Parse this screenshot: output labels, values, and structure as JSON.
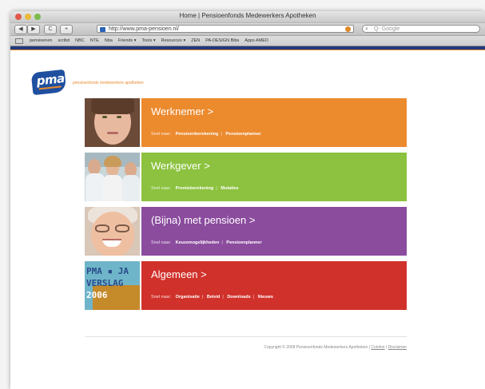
{
  "window": {
    "title": "Home | Pensioenfonds Medewerkers Apotheken"
  },
  "toolbar": {
    "url": "http://www.pma-pensioen.nl/",
    "search_placeholder": "Q- Google",
    "back": "◀",
    "forward": "▶",
    "reload": "C",
    "add": "+"
  },
  "bookmarks": [
    "pensioenen",
    "scribd",
    "NBC",
    "NTE",
    "Nba",
    "Friends ▾",
    "Tools ▾",
    "Resources ▾",
    "ZEN",
    "PA-DESIGN Bibs",
    "Apps AMED"
  ],
  "brand": {
    "logo": "pma",
    "tagline": "pensioenfonds medewerkers apotheken"
  },
  "label_go": "Snel naar:",
  "sections": [
    {
      "title": "Werknemer >",
      "color": "#ec8a2e",
      "links": [
        "Pensioenberekening",
        "Pensioenplanner"
      ]
    },
    {
      "title": "Werkgever >",
      "color": "#8cc23f",
      "links": [
        "Premieberekening",
        "Mutaties"
      ]
    },
    {
      "title": "(Bijna) met pensioen >",
      "color": "#8b4c9e",
      "links": [
        "Keuzemogelijkheden",
        "Pensioenplanner"
      ]
    },
    {
      "title": "Algemeen >",
      "color": "#d1312b",
      "links": [
        "Organisatie",
        "Beleid",
        "Downloads",
        "Nieuws"
      ]
    }
  ],
  "annual_report": {
    "line1": "PMA ▪ JA",
    "line2": "VERSLAG",
    "line3": "2006"
  },
  "footer": {
    "copyright": "Copyright © 2008 Pensioenfonds Medewerkers Apotheken |",
    "link1": "Colofon",
    "sep": "|",
    "link2": "Disclaimer"
  }
}
